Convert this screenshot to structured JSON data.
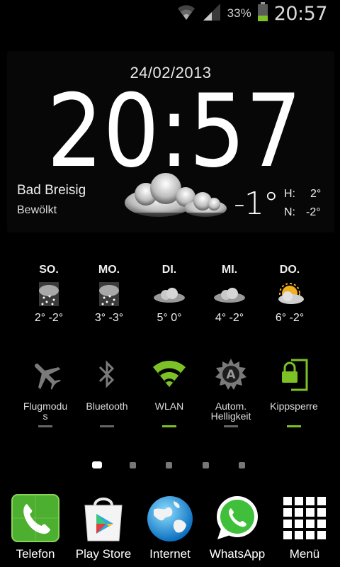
{
  "status_bar": {
    "battery_percent": "33%",
    "time": "20:57",
    "icons": [
      "wifi-icon",
      "signal-icon",
      "battery-icon"
    ],
    "battery_level": 0.33
  },
  "clock_widget": {
    "date": "24/02/2013",
    "time": "20:57",
    "city": "Bad Breisig",
    "condition": "Bewölkt",
    "temperature": "-1°",
    "high_label": "H:",
    "high_value": "2°",
    "low_label": "N:",
    "low_value": "-2°",
    "weather_icon": "cloud-icon"
  },
  "forecast": [
    {
      "day": "SO.",
      "temps": "2° -2°",
      "icon": "snow-cloud-icon"
    },
    {
      "day": "MO.",
      "temps": "3° -3°",
      "icon": "snow-cloud-icon"
    },
    {
      "day": "DI.",
      "temps": "5° 0°",
      "icon": "cloud-icon"
    },
    {
      "day": "MI.",
      "temps": "4° -2°",
      "icon": "cloud-icon"
    },
    {
      "day": "DO.",
      "temps": "6° -2°",
      "icon": "sun-cloud-icon"
    }
  ],
  "toggles": [
    {
      "label": "Flugmodus",
      "icon": "airplane-icon",
      "state": "off"
    },
    {
      "label": "Bluetooth",
      "icon": "bluetooth-icon",
      "state": "off"
    },
    {
      "label": "WLAN",
      "icon": "wifi-icon",
      "state": "on"
    },
    {
      "label": "Autom. Helligkeit",
      "icon": "auto-brightness-icon",
      "state": "off"
    },
    {
      "label": "Kippsperre",
      "icon": "rotation-lock-icon",
      "state": "on"
    }
  ],
  "home_pages": {
    "count": 5,
    "active_index": 0
  },
  "dock": [
    {
      "label": "Telefon",
      "icon": "phone-icon"
    },
    {
      "label": "Play Store",
      "icon": "play-store-icon"
    },
    {
      "label": "Internet",
      "icon": "globe-icon"
    },
    {
      "label": "WhatsApp",
      "icon": "whatsapp-icon"
    },
    {
      "label": "Menü",
      "icon": "app-grid-icon"
    }
  ],
  "colors": {
    "accent_green": "#7cc226",
    "toggle_off_gray": "#7a7a7a",
    "background": "#000000"
  }
}
